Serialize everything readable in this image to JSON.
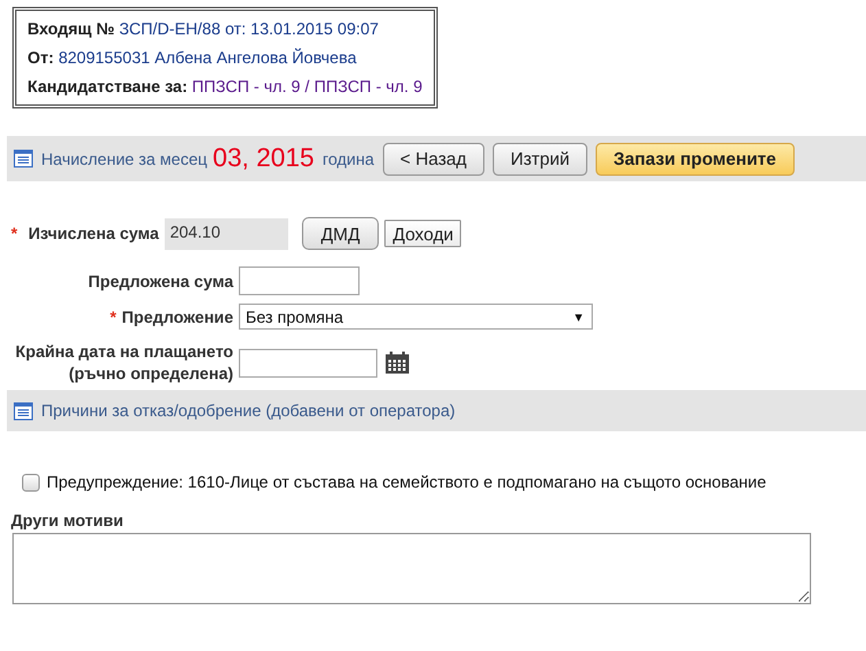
{
  "info_box": {
    "lines": [
      {
        "label": "Входящ №",
        "value": "ЗСП/D-ЕН/88 от: 13.01.2015 09:07"
      },
      {
        "label": "От:",
        "value": "8209155031 Албена Ангелова Йовчева"
      },
      {
        "label": "Кандидатстване за:",
        "value": "ППЗСП - чл. 9 / ППЗСП - чл. 9"
      }
    ]
  },
  "month_bar": {
    "prefix": "Начисление за месец",
    "period": "03, 2015",
    "suffix": "година",
    "buttons": [
      {
        "kind": "plain",
        "label": "< Назад"
      },
      {
        "kind": "plain",
        "label": "Изтрий"
      },
      {
        "kind": "primary",
        "label": "Запази промените"
      }
    ]
  },
  "form": {
    "computed": {
      "label": "Изчислена сума",
      "required_mark": "*",
      "value": "204.10",
      "buttons": [
        {
          "kind": "rounded",
          "label": "ДМД"
        },
        {
          "kind": "square",
          "label": "Доходи"
        }
      ]
    },
    "proposed": {
      "label": "Предложена сума"
    },
    "proposal": {
      "label": "Предложение",
      "required_mark": "*",
      "value": "Без промяна",
      "arrow": "▼"
    },
    "due_date": {
      "label_lines": [
        "Крайна дата на плащането",
        "(ръчно определена)"
      ]
    }
  },
  "reasons_bar": {
    "title": "Причини за отказ/одобрение (добавени от оператора)"
  },
  "warning": {
    "checked": false,
    "label": "Предупреждение: 1610-Лице от състава на семейството е подпомагано на същото основание"
  },
  "other_motives": {
    "label": "Други мотиви"
  }
}
